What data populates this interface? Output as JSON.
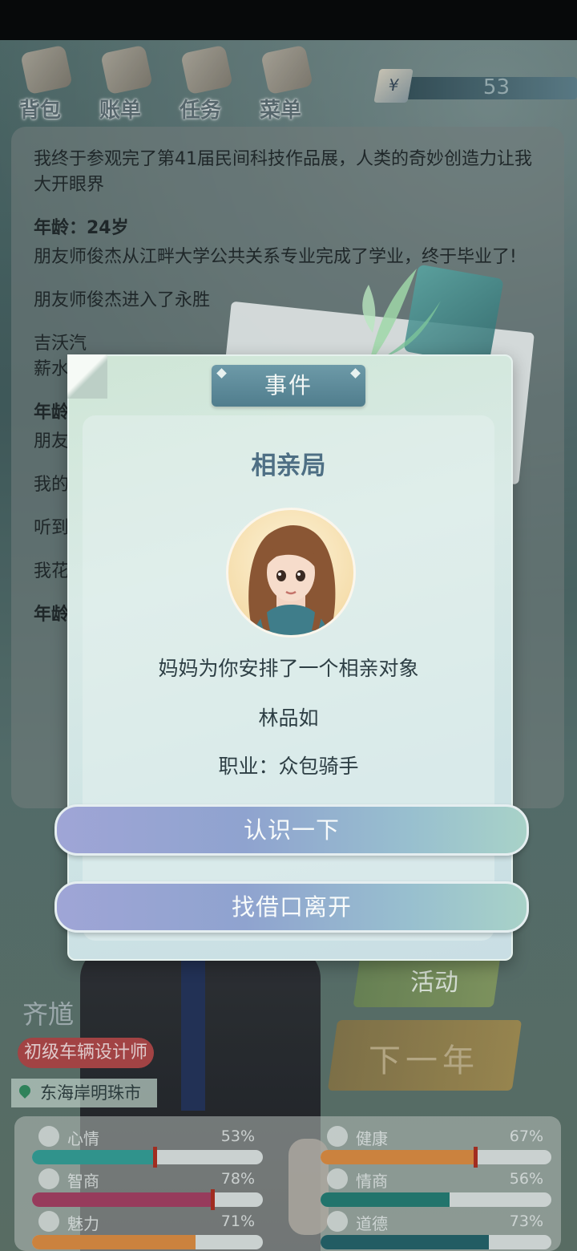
{
  "nav": {
    "items": [
      {
        "label": "背包",
        "icon": "backpack-icon"
      },
      {
        "label": "账单",
        "icon": "bill-icon"
      },
      {
        "label": "任务",
        "icon": "task-icon"
      },
      {
        "label": "菜单",
        "icon": "menu-icon"
      }
    ]
  },
  "money": {
    "symbol": "¥",
    "value": "53"
  },
  "log": {
    "entries": [
      {
        "type": "text",
        "text": "我终于参观完了第41届民间科技作品展，人类的奇妙创造力让我大开眼界"
      },
      {
        "type": "age",
        "text": "年龄：24岁"
      },
      {
        "type": "text",
        "text": "朋友师俊杰从江畔大学公共关系专业完成了学业，终于毕业了!"
      },
      {
        "type": "text",
        "text": "朋友师俊杰进入了永胜"
      },
      {
        "type": "text",
        "text": "吉沃汽"
      },
      {
        "type": "text",
        "text": "薪水"
      },
      {
        "type": "age",
        "text": "年龄"
      },
      {
        "type": "text",
        "text": "朋友"
      },
      {
        "type": "text",
        "text": "我的"
      },
      {
        "type": "text",
        "text": "听到"
      },
      {
        "type": "text",
        "text": "我花"
      },
      {
        "type": "age",
        "text": "年龄"
      }
    ]
  },
  "player": {
    "name": "齐馗",
    "job": "初级车辆设计师",
    "location": "东海岸明珠市"
  },
  "actions": {
    "activity": "活动",
    "next_year": "下一年"
  },
  "stats": [
    {
      "label": "心情",
      "value": "53%",
      "pct": 53,
      "color": "#2f9e94",
      "icon": "smile-icon"
    },
    {
      "label": "健康",
      "value": "67%",
      "pct": 67,
      "color": "#e08a3c",
      "icon": "heart-icon"
    },
    {
      "label": "智商",
      "value": "78%",
      "pct": 78,
      "color": "#a43a5e",
      "icon": "bulb-icon"
    },
    {
      "label": "情商",
      "value": "56%",
      "pct": 56,
      "color": "#1f7a70",
      "icon": "apple-icon"
    },
    {
      "label": "魅力",
      "value": "71%",
      "pct": 71,
      "color": "#e08a3c",
      "icon": "sparkle-icon"
    },
    {
      "label": "道德",
      "value": "73%",
      "pct": 73,
      "color": "#1f5f66",
      "icon": "scale-icon"
    }
  ],
  "modal": {
    "tab_label": "事件",
    "title": "相亲局",
    "description": "妈妈为你安排了一个相亲对象",
    "person_name": "林品如",
    "person_job": "职业：众包骑手",
    "choice_accept": "认识一下",
    "choice_leave": "找借口离开"
  },
  "colors": {
    "accent_blue": "#4e6f84",
    "tab": "#5e8a98",
    "choice_left": "#9fa5d6",
    "choice_right": "#a8d2c8"
  }
}
